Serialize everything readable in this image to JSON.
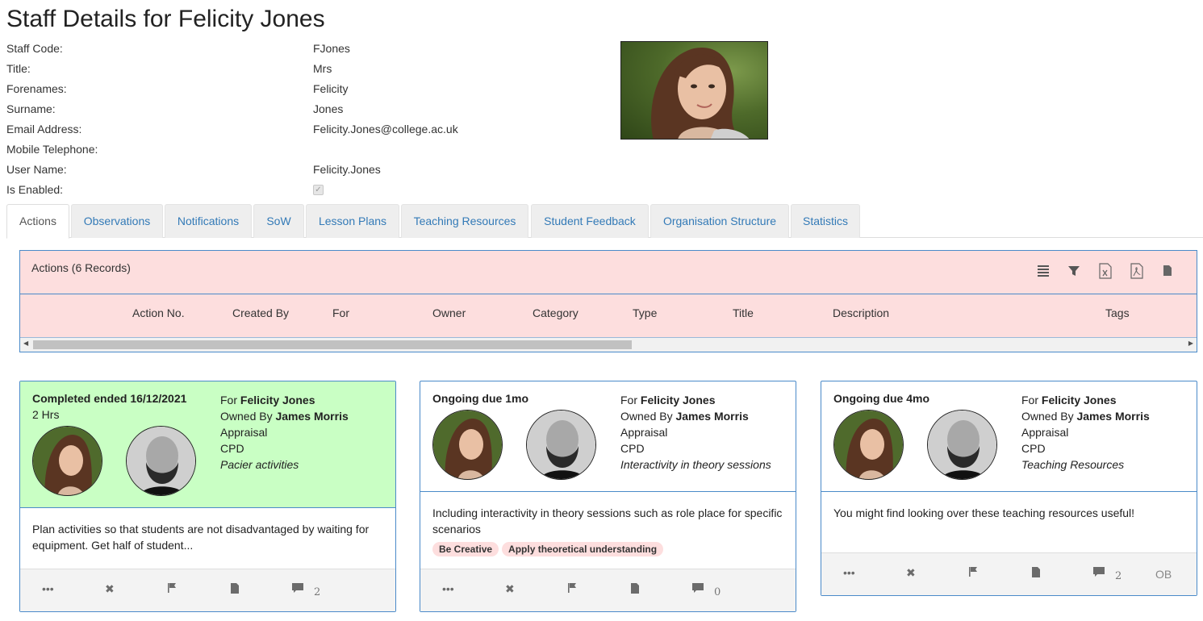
{
  "page": {
    "title": "Staff Details for Felicity Jones"
  },
  "details": [
    {
      "label": "Staff Code:",
      "value": "FJones"
    },
    {
      "label": "Title:",
      "value": "Mrs"
    },
    {
      "label": "Forenames:",
      "value": "Felicity"
    },
    {
      "label": "Surname:",
      "value": "Jones"
    },
    {
      "label": "Email Address:",
      "value": "Felicity.Jones@college.ac.uk"
    },
    {
      "label": "Mobile Telephone:",
      "value": ""
    },
    {
      "label": "User Name:",
      "value": "Felicity.Jones"
    },
    {
      "label": "Is Enabled:",
      "checked": true
    }
  ],
  "tabs": [
    "Actions",
    "Observations",
    "Notifications",
    "SoW",
    "Lesson Plans",
    "Teaching Resources",
    "Student Feedback",
    "Organisation Structure",
    "Statistics"
  ],
  "active_tab": "Actions",
  "grid": {
    "title": "Actions (6 Records)",
    "toolbar_icons": [
      "columns-icon",
      "filter-icon",
      "excel-export-icon",
      "pdf-export-icon",
      "document-icon"
    ],
    "columns": [
      "Action No.",
      "Created By",
      "For",
      "Owner",
      "Category",
      "Type",
      "Title",
      "Description",
      "Tags"
    ]
  },
  "cards": [
    {
      "status": "Completed ended 16/12/2021",
      "duration": "2 Hrs",
      "for_label": "For",
      "for_name": "Felicity Jones",
      "owner_label": "Owned By",
      "owner_name": "James Morris",
      "category": "Appraisal",
      "type": "CPD",
      "title": "Pacier activities",
      "description": "Plan activities so that students are not disadvantaged by waiting for equipment. Get half of student...",
      "tags": [],
      "comments": "2",
      "footer_extra": "",
      "completed": true
    },
    {
      "status": "Ongoing due 1mo",
      "duration": "",
      "for_label": "For",
      "for_name": "Felicity Jones",
      "owner_label": "Owned By",
      "owner_name": "James Morris",
      "category": "Appraisal",
      "type": "CPD",
      "title": "Interactivity in theory sessions",
      "description": "Including interactivity in theory sessions such as role place for specific scenarios",
      "tags": [
        "Be Creative",
        "Apply theoretical understanding"
      ],
      "comments": "0",
      "footer_extra": "",
      "completed": false
    },
    {
      "status": "Ongoing due 4mo",
      "duration": "",
      "for_label": "For",
      "for_name": "Felicity Jones",
      "owner_label": "Owned By",
      "owner_name": "James Morris",
      "category": "Appraisal",
      "type": "CPD",
      "title": "Teaching Resources",
      "description": "You might find looking over these teaching resources useful!",
      "tags": [],
      "comments": "2",
      "footer_extra": "OB",
      "completed": false
    }
  ],
  "colors": {
    "link": "#337ab7",
    "grid_header": "#fddede",
    "completed_card": "#c9ffc4",
    "border_blue": "#4a8ac9"
  }
}
